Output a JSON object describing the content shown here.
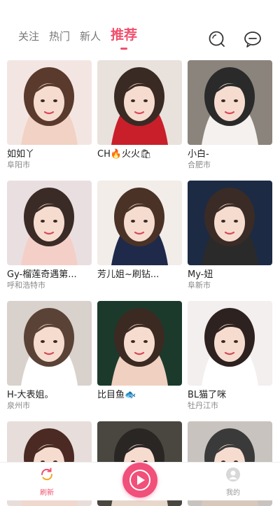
{
  "header": {
    "tabs": [
      {
        "label": "关注"
      },
      {
        "label": "热门"
      },
      {
        "label": "新人"
      },
      {
        "label": "推荐"
      }
    ],
    "active_tab": "推荐",
    "icons": [
      "search-icon",
      "message-icon"
    ]
  },
  "cards": [
    {
      "name": "如如丫",
      "city": "阜阳市",
      "colors": [
        "#f3e6e2",
        "#5a3a2c",
        "#f2d2c4"
      ]
    },
    {
      "name": "CH🔥火火🛍",
      "city": "",
      "colors": [
        "#e9e2dc",
        "#3a2a24",
        "#c91f2b"
      ]
    },
    {
      "name": "小白-",
      "city": "合肥市",
      "colors": [
        "#8b847c",
        "#2a2a2a",
        "#f4f1ee"
      ]
    },
    {
      "name": "Gy-榴莲奇遇第...",
      "city": "呼和浩特市",
      "colors": [
        "#eadfe0",
        "#3b2b26",
        "#f4cfc8"
      ]
    },
    {
      "name": "芳儿姐~刷钻...",
      "city": "",
      "colors": [
        "#f2ede8",
        "#4a3226",
        "#1f2a4a"
      ]
    },
    {
      "name": "My-妞",
      "city": "阜新市",
      "colors": [
        "#1c2a44",
        "#3a2b26",
        "#2a2a2a"
      ]
    },
    {
      "name": "H-大表姐。",
      "city": "泉州市",
      "colors": [
        "#d9d2cc",
        "#5a4336",
        "#ffffff"
      ]
    },
    {
      "name": "比目鱼🐟",
      "city": "",
      "colors": [
        "#1b3a2c",
        "#3b2a22",
        "#f0d0c0"
      ]
    },
    {
      "name": "BL猫了咪",
      "city": "牡丹江市",
      "colors": [
        "#f3efee",
        "#2e2220",
        "#ffffff"
      ]
    },
    {
      "name": "",
      "city": "",
      "colors": [
        "#e7dedb",
        "#4a2a22",
        "#f0d8ce"
      ]
    },
    {
      "name": "",
      "city": "",
      "colors": [
        "#4a4640",
        "#2a2624",
        "#e8d8cc"
      ]
    },
    {
      "name": "",
      "city": "",
      "colors": [
        "#c8c3be",
        "#3a3a3a",
        "#d8c8bc"
      ]
    }
  ],
  "bottom_nav": {
    "refresh_label": "刷新",
    "me_label": "我的"
  },
  "theme": {
    "accent": "#f0506e"
  }
}
